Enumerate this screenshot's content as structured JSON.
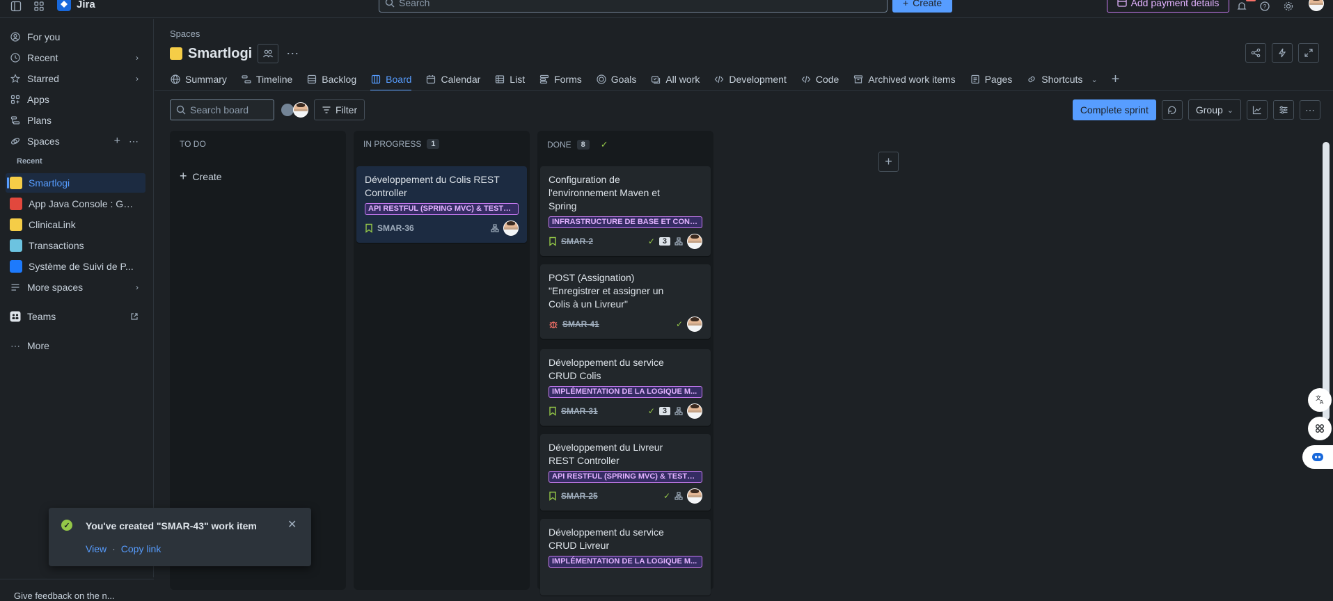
{
  "topbar": {
    "app_name": "Jira",
    "search_placeholder": "Search",
    "create_label": "Create",
    "payment_label": "Add payment details"
  },
  "sidebar": {
    "items": [
      {
        "label": "For you",
        "icon": "user-circle-icon"
      },
      {
        "label": "Recent",
        "icon": "clock-icon"
      },
      {
        "label": "Starred",
        "icon": "star-icon"
      },
      {
        "label": "Apps",
        "icon": "apps-icon"
      },
      {
        "label": "Plans",
        "icon": "plans-icon"
      },
      {
        "label": "Spaces",
        "icon": "spaces-icon"
      }
    ],
    "recent_label": "Recent",
    "spaces": [
      {
        "label": "Smartlogi",
        "color": "#f5cd47"
      },
      {
        "label": "App Java Console : Ge...",
        "color": "#e2483d"
      },
      {
        "label": "ClinicaLink",
        "color": "#f5cd47"
      },
      {
        "label": "Transactions",
        "color": "#6cc3e0"
      },
      {
        "label": "Système de Suivi de P...",
        "color": "#1d7afc"
      }
    ],
    "more_spaces": "More spaces",
    "teams": "Teams",
    "more": "More",
    "bottom_text": "Give feedback on the n..."
  },
  "header": {
    "breadcrumb": "Spaces",
    "title": "Smartlogi",
    "tabs": [
      {
        "label": "Summary",
        "icon": "globe-icon"
      },
      {
        "label": "Timeline",
        "icon": "timeline-icon"
      },
      {
        "label": "Backlog",
        "icon": "backlog-icon"
      },
      {
        "label": "Board",
        "icon": "board-icon"
      },
      {
        "label": "Calendar",
        "icon": "calendar-icon"
      },
      {
        "label": "List",
        "icon": "list-icon"
      },
      {
        "label": "Forms",
        "icon": "forms-icon"
      },
      {
        "label": "Goals",
        "icon": "goals-icon"
      },
      {
        "label": "All work",
        "icon": "all-work-icon"
      },
      {
        "label": "Development",
        "icon": "development-icon"
      },
      {
        "label": "Code",
        "icon": "code-icon"
      },
      {
        "label": "Archived work items",
        "icon": "archive-icon"
      },
      {
        "label": "Pages",
        "icon": "pages-icon"
      },
      {
        "label": "Shortcuts",
        "icon": "link-icon"
      }
    ]
  },
  "toolbar": {
    "search_placeholder": "Search board",
    "filter_label": "Filter",
    "complete_label": "Complete sprint",
    "group_label": "Group"
  },
  "columns": {
    "todo": {
      "title": "TO DO",
      "create": "Create"
    },
    "inprogress": {
      "title": "IN PROGRESS",
      "count": "1",
      "cards": [
        {
          "title": "Développement du Colis REST Controller",
          "epic": "API RESTFUL (SPRING MVC) & TESTS ...",
          "key": "SMAR-36"
        }
      ]
    },
    "done": {
      "title": "DONE",
      "count": "8",
      "cards": [
        {
          "title": "Configuration de l'environnement Maven et Spring",
          "epic": "INFRASTRUCTURE DE BASE ET CONFI...",
          "key": "SMAR-2",
          "subtasks": "3"
        },
        {
          "title": "POST (Assignation) \"Enregistrer et assigner un Colis à un Livreur\"",
          "key": "SMAR-41"
        },
        {
          "title": "Développement du service CRUD Colis",
          "epic": "IMPLÉMENTATION DE LA LOGIQUE M...",
          "key": "SMAR-31",
          "subtasks": "3"
        },
        {
          "title": "Développement du Livreur REST Controller",
          "epic": "API RESTFUL (SPRING MVC) & TESTS ...",
          "key": "SMAR-25"
        },
        {
          "title": "Développement du service CRUD Livreur",
          "epic": "IMPLÉMENTATION DE LA LOGIQUE M..."
        }
      ]
    }
  },
  "toast": {
    "message": "You've created \"SMAR-43\" work item",
    "view": "View",
    "copy": "Copy link"
  },
  "colors": {
    "accent": "#579dff",
    "epic": "#c97cf4",
    "background": "#1d2125"
  }
}
